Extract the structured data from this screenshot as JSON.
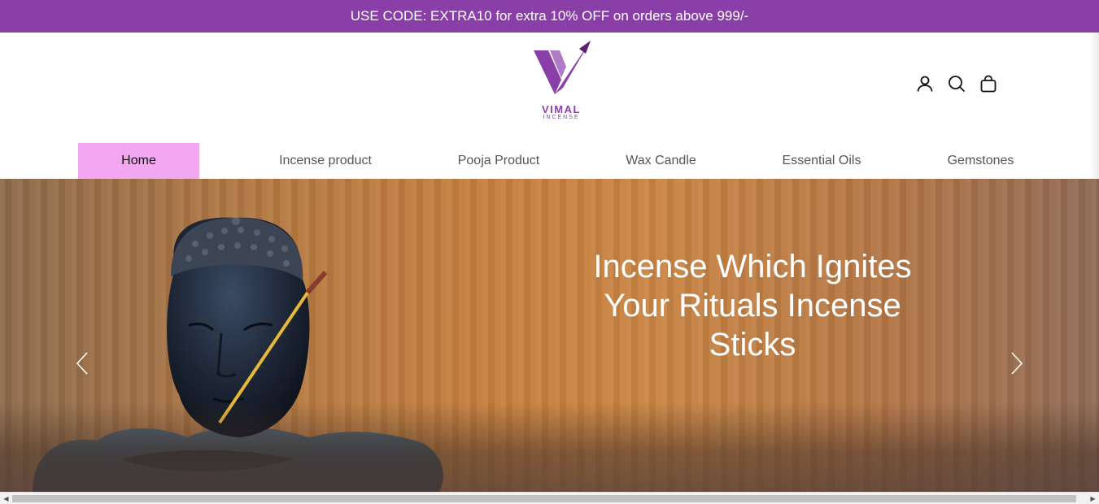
{
  "announcement": {
    "text": "USE CODE: EXTRA10 for extra 10% OFF on orders above 999/-"
  },
  "brand": {
    "name": "VIMAL",
    "tagline": "INCENSE",
    "color": "#8a3fa8"
  },
  "header": {
    "icons": [
      "account-icon",
      "search-icon",
      "cart-icon"
    ]
  },
  "nav": {
    "items": [
      {
        "label": "Home",
        "active": true
      },
      {
        "label": "Incense product"
      },
      {
        "label": "Pooja Product"
      },
      {
        "label": "Wax Candle"
      },
      {
        "label": "Essential Oils"
      },
      {
        "label": "Gemstones"
      }
    ],
    "active_bg": "#f2a8f0"
  },
  "hero": {
    "title": "Incense Which Ignites Your Rituals Incense Sticks",
    "prev_icon": "chevron-left-icon",
    "next_icon": "chevron-right-icon"
  }
}
